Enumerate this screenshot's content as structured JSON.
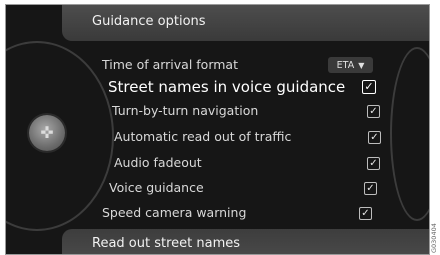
{
  "header": {
    "title": "Guidance options"
  },
  "menu": {
    "time_of_arrival": {
      "label": "Time of arrival format",
      "value": "ETA",
      "dropdown_icon": "triangle-down-icon"
    },
    "items": [
      {
        "label": "Street names in voice guidance",
        "checked": true,
        "selected": true
      },
      {
        "label": "Turn-by-turn navigation",
        "checked": true,
        "selected": false
      },
      {
        "label": "Automatic read out of traffic",
        "checked": true,
        "selected": false
      },
      {
        "label": "Audio fadeout",
        "checked": true,
        "selected": false
      },
      {
        "label": "Voice guidance",
        "checked": true,
        "selected": false
      },
      {
        "label": "Speed camera warning",
        "checked": true,
        "selected": false
      }
    ]
  },
  "footer": {
    "label": "Read out street names"
  },
  "knob": {
    "icon": "compass-icon"
  },
  "side_code": "G030404",
  "check_glyph": "✓",
  "colors": {
    "background": "#161616",
    "bar": "#454545",
    "text": "#d8d8d8",
    "selected_text": "#ffffff"
  }
}
